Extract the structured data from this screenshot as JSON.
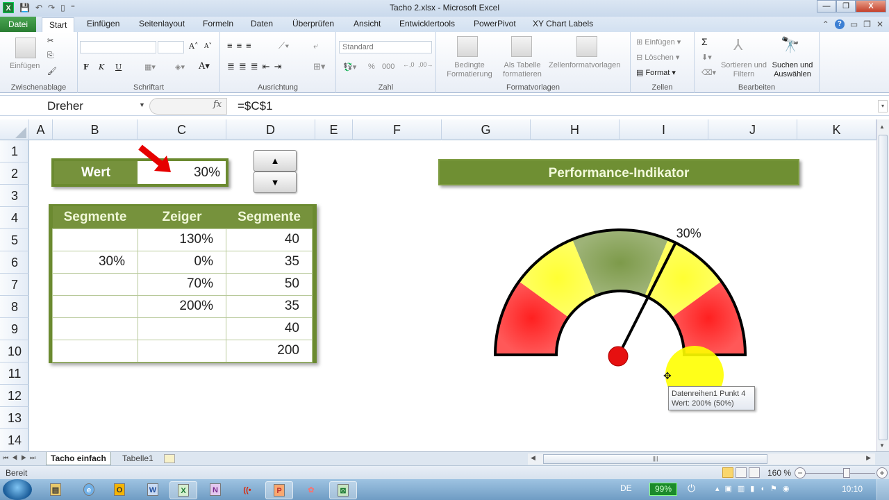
{
  "window": {
    "title": "Tacho 2.xlsx - Microsoft Excel",
    "controls": [
      "minimize",
      "restore",
      "close"
    ]
  },
  "ribbon_tabs": [
    "Datei",
    "Start",
    "Einfügen",
    "Seitenlayout",
    "Formeln",
    "Daten",
    "Überprüfen",
    "Ansicht",
    "Entwicklertools",
    "PowerPivot",
    "XY Chart Labels"
  ],
  "ribbon": {
    "clipboard": {
      "label": "Zwischenablage",
      "paste": "Einfügen"
    },
    "font": {
      "label": "Schriftart",
      "bold": "F",
      "italic": "K",
      "underline": "U"
    },
    "alignment": {
      "label": "Ausrichtung"
    },
    "number": {
      "label": "Zahl",
      "format": "Standard",
      "percent": "%",
      "thousands": "000"
    },
    "styles": {
      "label": "Formatvorlagen",
      "conditional": "Bedingte Formatierung",
      "table": "Als Tabelle formatieren",
      "cellstyles": "Zellenformatvorlagen"
    },
    "cells": {
      "label": "Zellen",
      "insert": "Einfügen",
      "delete": "Löschen",
      "format": "Format"
    },
    "editing": {
      "label": "Bearbeiten",
      "sort": "Sortieren und Filtern",
      "find": "Suchen und Auswählen"
    }
  },
  "formula_bar": {
    "name_box": "Dreher",
    "fx": "fx",
    "formula": "=$C$1"
  },
  "columns": [
    "A",
    "B",
    "C",
    "D",
    "E",
    "F",
    "G",
    "H",
    "I",
    "J",
    "K"
  ],
  "rows": [
    "1",
    "2",
    "3",
    "4",
    "5",
    "6",
    "7",
    "8",
    "9",
    "10",
    "11",
    "12",
    "13",
    "14"
  ],
  "wert_box": {
    "label": "Wert",
    "value": "30%"
  },
  "spinner": {
    "up": "▲",
    "down": "▼"
  },
  "table": {
    "headers": [
      "Segmente",
      "Zeiger",
      "Segmente"
    ],
    "rows": [
      [
        "",
        "130%",
        "40"
      ],
      [
        "30%",
        "0%",
        "35"
      ],
      [
        "",
        "70%",
        "50"
      ],
      [
        "",
        "200%",
        "35"
      ],
      [
        "",
        "",
        "40"
      ],
      [
        "",
        "",
        "200"
      ]
    ]
  },
  "chart": {
    "title": "Performance-Indikator",
    "needle_label": "30%",
    "needle_value_percent": 30,
    "segments": [
      {
        "value": 40,
        "color": "#ff2020"
      },
      {
        "value": 35,
        "color": "#ffff33"
      },
      {
        "value": 50,
        "color": "#7d9a4a"
      },
      {
        "value": 35,
        "color": "#ffff33"
      },
      {
        "value": 40,
        "color": "#ff2020"
      },
      {
        "value": 200,
        "color": "none"
      }
    ],
    "tooltip_line1": "Datenreihen1 Punkt 4",
    "tooltip_line2": "Wert: 200% (50%)"
  },
  "sheets": {
    "active": "Tacho einfach",
    "other": "Tabelle1"
  },
  "status": {
    "ready": "Bereit",
    "zoom": "160 %"
  },
  "taskbar": {
    "apps": [
      "Explorer",
      "Internet Explorer",
      "Outlook",
      "Word",
      "Excel",
      "OneNote",
      "Camtasia",
      "PowerPoint",
      "Snipping",
      "Excel-Addin"
    ],
    "lang": "DE",
    "battery": "99%",
    "time": "10:10"
  }
}
